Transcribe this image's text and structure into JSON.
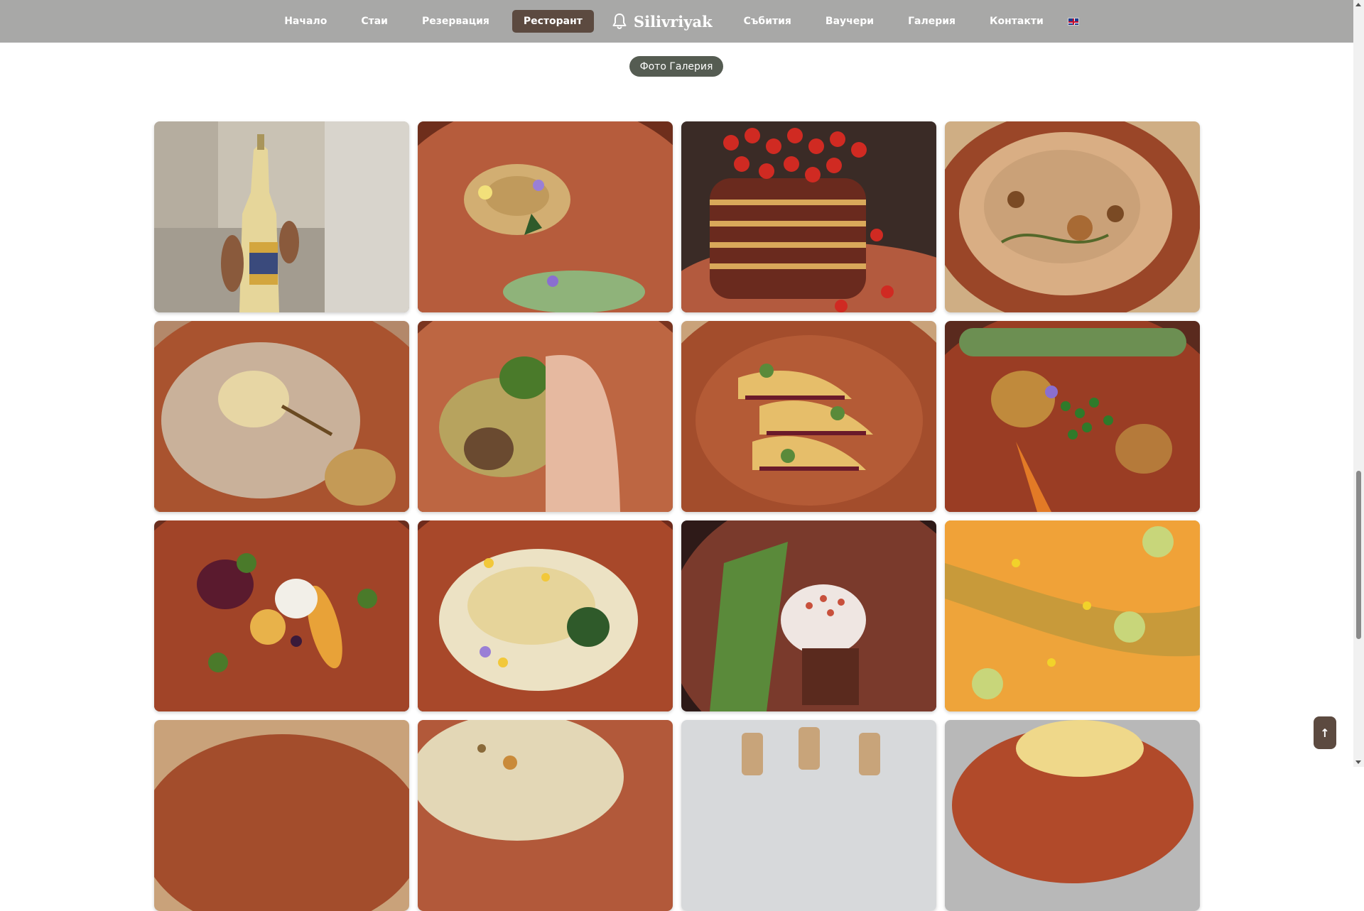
{
  "nav": {
    "items_left": [
      "Начало",
      "Стаи",
      "Резервация",
      "Ресторант"
    ],
    "brand": "Silivriyak",
    "items_right": [
      "Събития",
      "Ваучери",
      "Галерия",
      "Контакти"
    ],
    "active": "Ресторант",
    "language_flag": "uk-flag-icon"
  },
  "gallery": {
    "badge": "Фото Галерия",
    "photos": [
      "photo-wine-bottle",
      "photo-plated-dessert-flowers",
      "photo-pancake-stack-strawberries",
      "photo-soup-bowl",
      "photo-poached-pear-grains",
      "photo-trout-fillet",
      "photo-crepes-jam",
      "photo-grilled-vegetables-peas",
      "photo-beetroot-salad",
      "photo-creamy-dish-flowers",
      "photo-dessert-ice-cream",
      "photo-melon-slices",
      "photo-orange-plate",
      "photo-flatbread",
      "photo-cork-stoppers",
      "photo-plated-dish"
    ]
  },
  "back_to_top": "↑",
  "colors": {
    "nav_bg": "#a8a8a7",
    "active_bg": "#5c4a40",
    "badge_bg": "#555c52"
  }
}
